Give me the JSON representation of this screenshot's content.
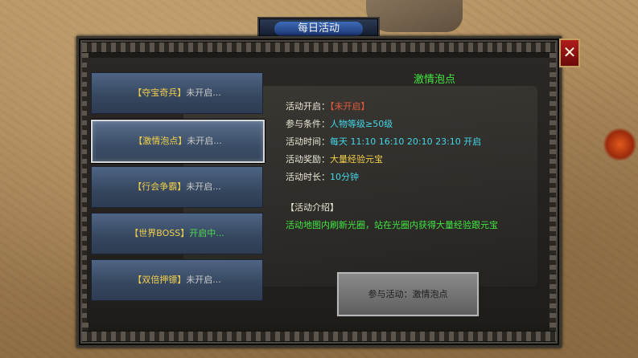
{
  "window": {
    "title": "每日活动",
    "close_label": "✕"
  },
  "tabs": [
    {
      "name": "【夺宝奇兵】",
      "status": "未开启...",
      "state": "off"
    },
    {
      "name": "【激情泡点】",
      "status": "未开启...",
      "state": "off",
      "active": true
    },
    {
      "name": "【行会争霸】",
      "status": "未开启...",
      "state": "off"
    },
    {
      "name": "【世界BOSS】",
      "status": "开启中...",
      "state": "on"
    },
    {
      "name": "【双倍押镖】",
      "status": "未开启...",
      "state": "off"
    }
  ],
  "detail": {
    "title": "激情泡点",
    "open_label": "活动开启：",
    "open_value": "【未开启】",
    "cond_label": "参与条件：",
    "cond_value": "人物等级≥50级",
    "time_label": "活动时间：",
    "time_value": "每天 11:10 16:10 20:10 23:10 开启",
    "reward_label": "活动奖励：",
    "reward_value": "大量经验元宝",
    "duration_label": "活动时长：",
    "duration_value": "10分钟",
    "intro_label": "【活动介绍】",
    "intro_text": "活动地图内刷新光圈，站在光圈内获得大量经验跟元宝"
  },
  "join_button": "参与活动：激情泡点",
  "colors": {
    "title_green": "#42e642",
    "tab_name_gold": "#f2cf4a",
    "status_on_green": "#4fd94f",
    "value_cyan": "#42d6e6",
    "value_red": "#e25a3a",
    "close_red": "#b01c1c"
  }
}
